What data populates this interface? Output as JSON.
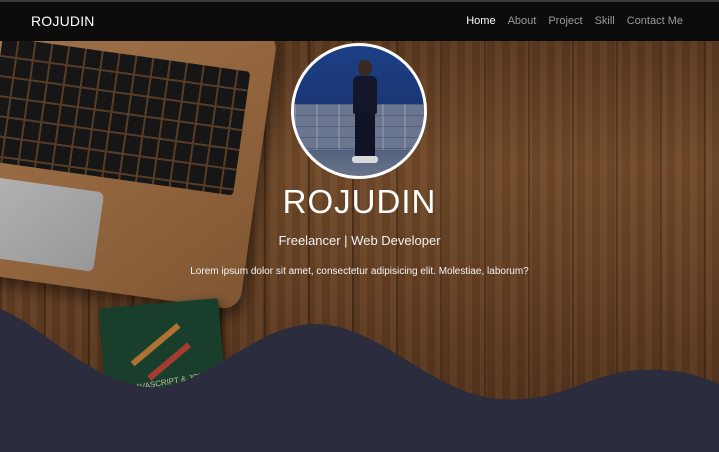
{
  "navbar": {
    "brand": "ROJUDIN",
    "links": [
      {
        "label": "Home",
        "active": true
      },
      {
        "label": "About",
        "active": false
      },
      {
        "label": "Project",
        "active": false
      },
      {
        "label": "Skill",
        "active": false
      },
      {
        "label": "Contact Me",
        "active": false
      }
    ]
  },
  "hero": {
    "name": "ROJUDIN",
    "subtitle": "Freelancer | Web Developer",
    "lead": "Lorem ipsum dolor sit amet, consectetur adipisicing elit. Molestiae, laborum?",
    "book_text": "JAVASCRIPT & JQUERY"
  },
  "colors": {
    "navbar_bg": "#0c0c0c",
    "wave_fill": "#2b2c3d",
    "text": "#ffffff",
    "nav_inactive": "#9a9a9a"
  }
}
